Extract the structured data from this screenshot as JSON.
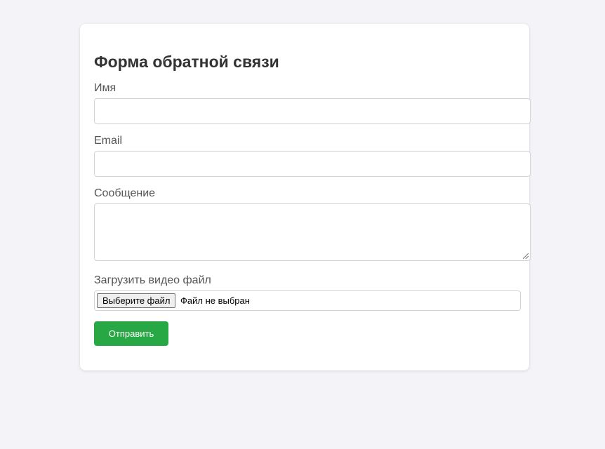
{
  "form": {
    "title": "Форма обратной связи",
    "name_label": "Имя",
    "name_value": "",
    "email_label": "Email",
    "email_value": "",
    "message_label": "Сообщение",
    "message_value": "",
    "file_label": "Загрузить видео файл",
    "file_button_label": "Выберите файл",
    "file_status": "Файл не выбран",
    "submit_label": "Отправить"
  },
  "colors": {
    "background": "#f4f4f8",
    "card": "#ffffff",
    "submit": "#28a745",
    "border": "#d3d3d3"
  }
}
